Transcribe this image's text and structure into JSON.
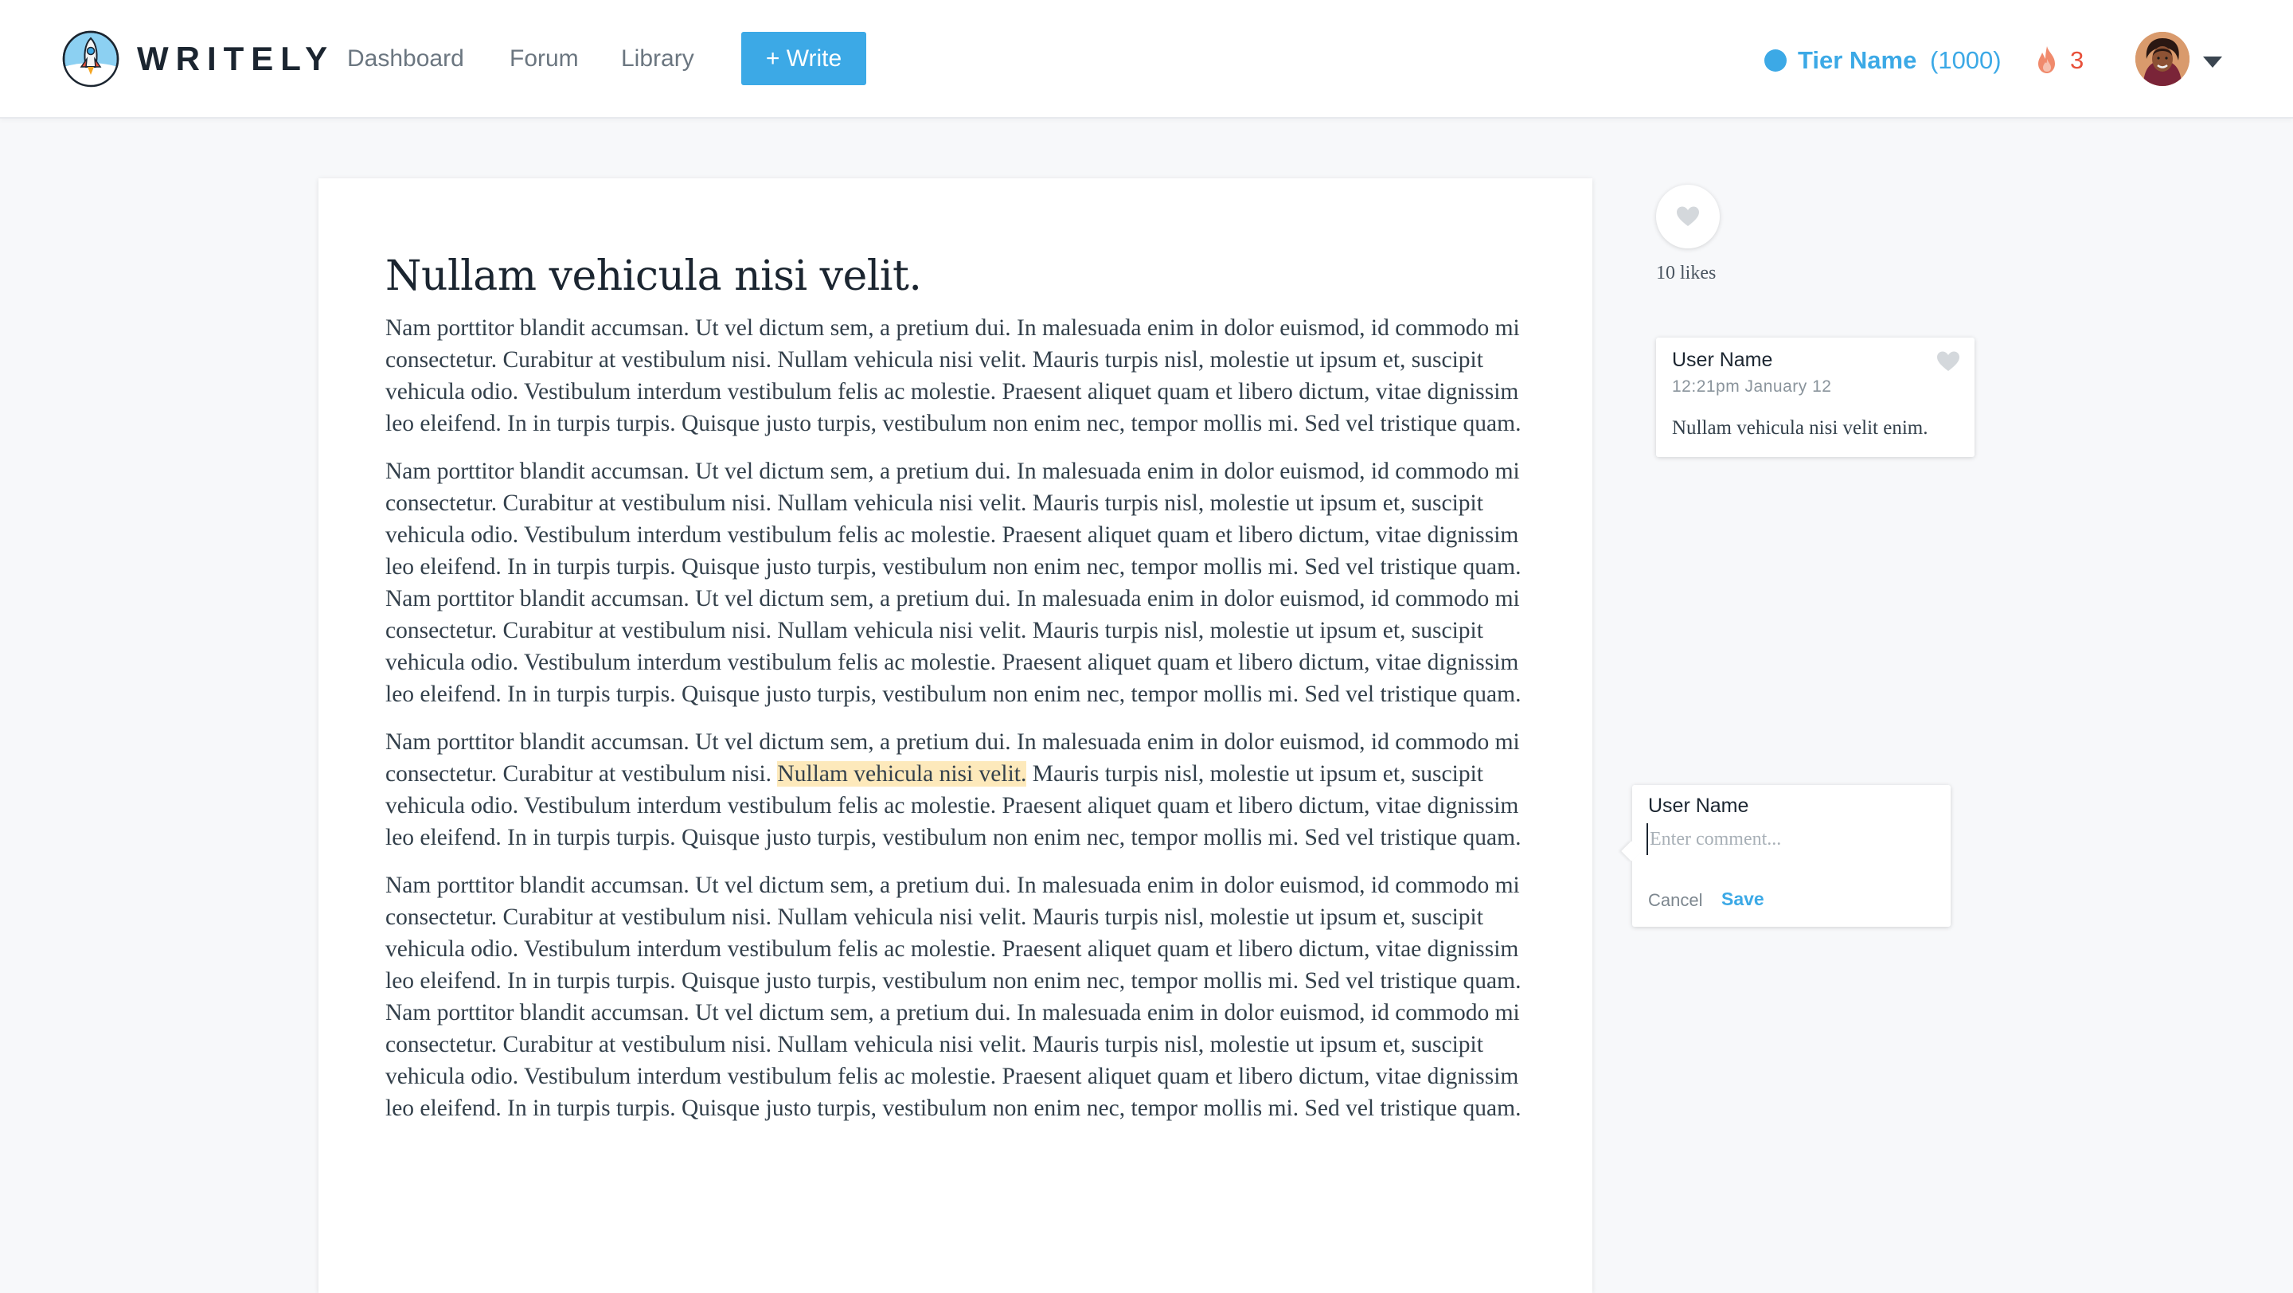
{
  "header": {
    "logo_text": "WRITELY",
    "nav": [
      {
        "label": "Dashboard"
      },
      {
        "label": "Forum"
      },
      {
        "label": "Library"
      }
    ],
    "write_button": "+ Write",
    "tier": {
      "name": "Tier Name",
      "points": "(1000)",
      "color": "#3ca9e6"
    },
    "streak": "3",
    "avatar_icon": "user-avatar",
    "caret_icon": "chevron-down-icon"
  },
  "article": {
    "title": "Nullam vehicula nisi velit.",
    "paragraphs": [
      "Nam porttitor blandit accumsan. Ut vel dictum sem, a pretium dui. In malesuada enim in dolor euismod, id commodo mi consectetur. Curabitur at vestibulum nisi. Nullam vehicula nisi velit. Mauris turpis nisl, molestie ut ipsum et, suscipit vehicula odio. Vestibulum interdum vestibulum felis ac molestie. Praesent aliquet quam et libero dictum, vitae dignissim leo eleifend. In in turpis turpis. Quisque justo turpis, vestibulum non enim nec, tempor mollis mi. Sed vel tristique quam.",
      "Nam porttitor blandit accumsan. Ut vel dictum sem, a pretium dui. In malesuada enim in dolor euismod, id commodo mi consectetur. Curabitur at vestibulum nisi. Nullam vehicula nisi velit. Mauris turpis nisl, molestie ut ipsum et, suscipit vehicula odio. Vestibulum interdum vestibulum felis ac molestie. Praesent aliquet quam et libero dictum, vitae dignissim leo eleifend. In in turpis turpis. Quisque justo turpis, vestibulum non enim nec, tempor mollis mi. Sed vel tristique quam. Nam porttitor blandit accumsan. Ut vel dictum sem, a pretium dui. In malesuada enim in dolor euismod, id commodo mi consectetur. Curabitur at vestibulum nisi. Nullam vehicula nisi velit. Mauris turpis nisl, molestie ut ipsum et, suscipit vehicula odio. Vestibulum interdum vestibulum felis ac molestie. Praesent aliquet quam et libero dictum, vitae dignissim leo eleifend. In in turpis turpis. Quisque justo turpis, vestibulum non enim nec, tempor mollis mi. Sed vel tristique quam.",
      {
        "before": "Nam porttitor blandit accumsan. Ut vel dictum sem, a pretium dui. In malesuada enim in dolor euismod, id commodo mi consectetur. Curabitur at vestibulum nisi. ",
        "highlight": "Nullam vehicula nisi velit.",
        "after": " Mauris turpis nisl, molestie ut ipsum et, suscipit vehicula odio. Vestibulum interdum vestibulum felis ac molestie. Praesent aliquet quam et libero dictum, vitae dignissim leo eleifend. In in turpis turpis. Quisque justo turpis, vestibulum non enim nec, tempor mollis mi. Sed vel tristique quam."
      },
      "Nam porttitor blandit accumsan. Ut vel dictum sem, a pretium dui. In malesuada enim in dolor euismod, id commodo mi consectetur. Curabitur at vestibulum nisi. Nullam vehicula nisi velit. Mauris turpis nisl, molestie ut ipsum et, suscipit vehicula odio. Vestibulum interdum vestibulum felis ac molestie. Praesent aliquet quam et libero dictum, vitae dignissim leo eleifend. In in turpis turpis. Quisque justo turpis, vestibulum non enim nec, tempor mollis mi. Sed vel tristique quam. Nam porttitor blandit accumsan. Ut vel dictum sem, a pretium dui. In malesuada enim in dolor euismod, id commodo mi consectetur. Curabitur at vestibulum nisi. Nullam vehicula nisi velit. Mauris turpis nisl, molestie ut ipsum et, suscipit vehicula odio. Vestibulum interdum vestibulum felis ac molestie. Praesent aliquet quam et libero dictum, vitae dignissim leo eleifend. In in turpis turpis. Quisque justo turpis, vestibulum non enim nec, tempor mollis mi. Sed vel tristique quam."
    ],
    "highlight_color": "#fde9bb"
  },
  "sidebar": {
    "likes_label": "10 likes",
    "comment": {
      "user": "User Name",
      "time": "12:21pm  January 12",
      "text": "Nullam vehicula nisi velit enim."
    },
    "new_comment": {
      "user": "User Name",
      "placeholder": "Enter comment...",
      "value": "",
      "cancel": "Cancel",
      "save": "Save"
    }
  }
}
